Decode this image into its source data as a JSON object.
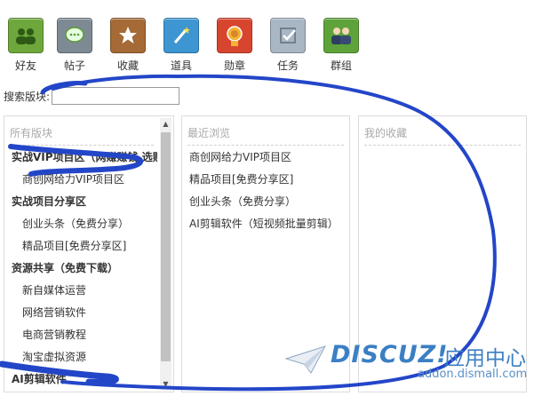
{
  "toolbar": {
    "items": [
      {
        "label": "好友",
        "icon": "friends-icon",
        "color": "#6ea83c"
      },
      {
        "label": "帖子",
        "icon": "chat-bubble-icon",
        "color": "#7d8a94"
      },
      {
        "label": "收藏",
        "icon": "star-icon",
        "color": "#a56a36"
      },
      {
        "label": "道具",
        "icon": "magic-wand-icon",
        "color": "#3d96d2"
      },
      {
        "label": "勋章",
        "icon": "medal-icon",
        "color": "#d8452e"
      },
      {
        "label": "任务",
        "icon": "task-check-icon",
        "color": "#a9b6c4"
      },
      {
        "label": "群组",
        "icon": "group-icon",
        "color": "#5da33a"
      }
    ]
  },
  "search": {
    "label": "搜索版块:",
    "value": ""
  },
  "panels": {
    "all": {
      "title": "所有版块",
      "items": [
        {
          "text": "实战VIP项目区（网赚赚钱 选购区）",
          "kind": "group"
        },
        {
          "text": "商创网给力VIP项目区",
          "kind": "sub"
        },
        {
          "text": "实战项目分享区",
          "kind": "group"
        },
        {
          "text": "创业头条（免费分享）",
          "kind": "sub"
        },
        {
          "text": "精品项目[免费分享区]",
          "kind": "sub"
        },
        {
          "text": "资源共享（免费下载）",
          "kind": "group"
        },
        {
          "text": "新自媒体运营",
          "kind": "sub"
        },
        {
          "text": "网络营销软件",
          "kind": "sub"
        },
        {
          "text": "电商营销教程",
          "kind": "sub"
        },
        {
          "text": "淘宝虚拟资源",
          "kind": "sub"
        },
        {
          "text": "AI剪辑软件",
          "kind": "group"
        }
      ]
    },
    "recent": {
      "title": "最近浏览",
      "items": [
        {
          "text": "商创网给力VIP项目区"
        },
        {
          "text": "精品项目[免费分享区]"
        },
        {
          "text": "创业头条（免费分享）"
        },
        {
          "text": "AI剪辑软件（短视频批量剪辑）"
        }
      ]
    },
    "favorites": {
      "title": "我的收藏"
    }
  },
  "watermark": {
    "brand": "DISCUZ!",
    "cn": "应用中心",
    "url": "addon.dismall.com"
  },
  "annotation_color": "#2346c8"
}
